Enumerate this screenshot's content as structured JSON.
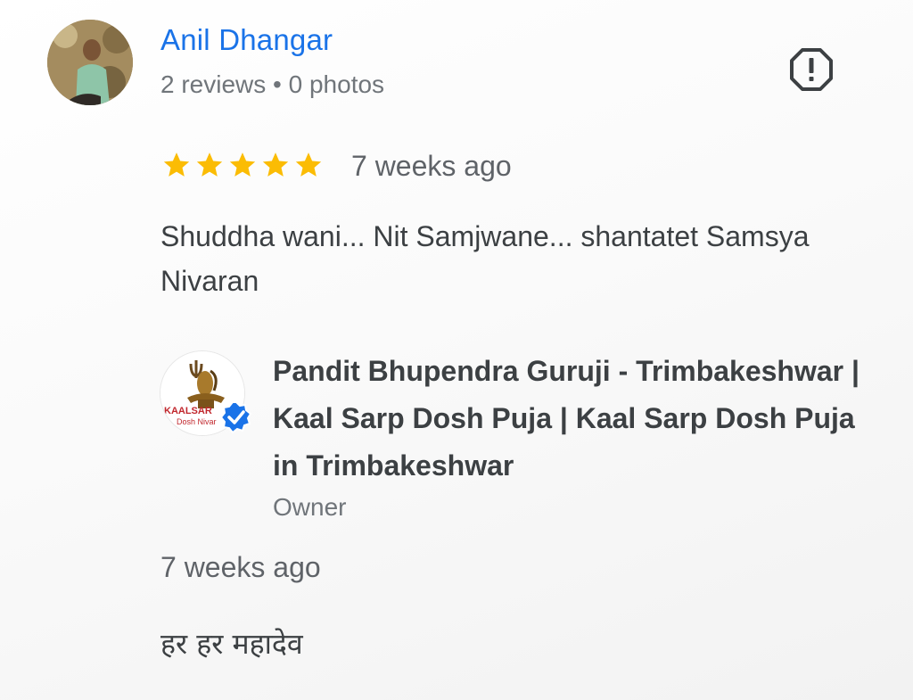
{
  "review": {
    "reviewer_name": "Anil Dhangar",
    "reviewer_meta": "2 reviews • 0 photos",
    "rating": 5,
    "rating_max": 5,
    "star_color": "#fbbc04",
    "time_ago": "7 weeks ago",
    "text": "Shuddha wani... Nit Samjwane... shantatet Samsya Nivaran",
    "flag_icon": "report-icon"
  },
  "owner_reply": {
    "owner_name": "Pandit Bhupendra Guruji - Trimbakeshwar | Kaal Sarp Dosh Puja | Kaal Sarp Dosh Puja in Trimbakeshwar",
    "role": "Owner",
    "time_ago": "7 weeks ago",
    "text": "हर हर महादेव",
    "logo_text_line1": "KAALSAR",
    "logo_text_line2": "Dosh Nivar",
    "verified_icon": "verified-check-icon"
  },
  "colors": {
    "link": "#1a73e8",
    "secondary": "#70757a",
    "primary_text": "#3c4043",
    "verified": "#1a73e8"
  }
}
